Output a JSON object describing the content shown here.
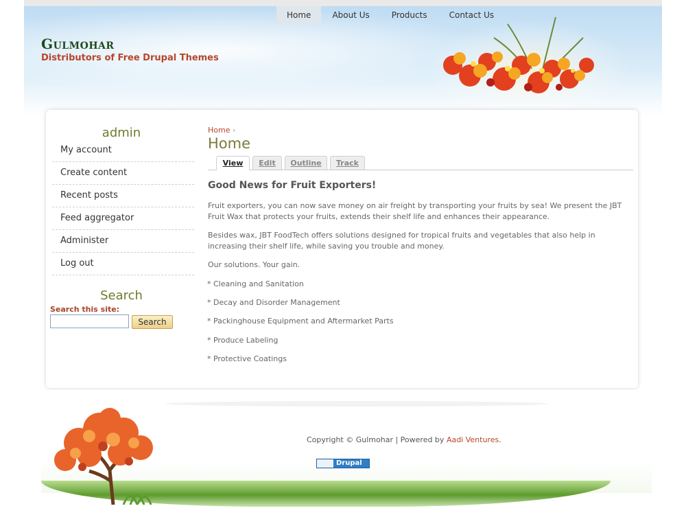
{
  "nav": {
    "items": [
      "Home",
      "About Us",
      "Products",
      "Contact Us"
    ],
    "active_index": 0
  },
  "site": {
    "name": "Gulmohar",
    "slogan": "Distributors of Free Drupal Themes"
  },
  "sidebar": {
    "user_block_title": "admin",
    "menu": [
      "My account",
      "Create content",
      "Recent posts",
      "Feed aggregator",
      "Administer",
      "Log out"
    ],
    "search": {
      "title": "Search",
      "label": "Search this site:",
      "value": "",
      "button": "Search"
    }
  },
  "content": {
    "breadcrumb": {
      "link": "Home",
      "separator": "›"
    },
    "title": "Home",
    "tabs": [
      "View",
      "Edit",
      "Outline",
      "Track"
    ],
    "active_tab": "View",
    "node_title": "Good News for Fruit Exporters!",
    "paragraphs": [
      "Fruit exporters, you can now save money on air freight by transporting your fruits by sea! We present the JBT Fruit Wax that protects your fruits, extends their shelf life and enhances their appearance.",
      "Besides wax, JBT FoodTech offers solutions designed for tropical fruits and vegetables that also help in increasing their shelf life, while saving you trouble and money.",
      "Our solutions. Your gain."
    ],
    "list": [
      "* Cleaning and Sanitation",
      "* Decay and Disorder Management",
      "* Packinghouse Equipment and Aftermarket Parts",
      "* Produce Labeling",
      "* Protective Coatings"
    ]
  },
  "footer": {
    "copyright_prefix": "Copyright © Gulmohar | Powered by",
    "powered_by_link": "Aadi Ventures",
    "suffix": ".",
    "badge": "Drupal"
  },
  "colors": {
    "accent": "#b8452a",
    "title_olive": "#7c7a3a",
    "site_name": "#1f4a1c"
  }
}
